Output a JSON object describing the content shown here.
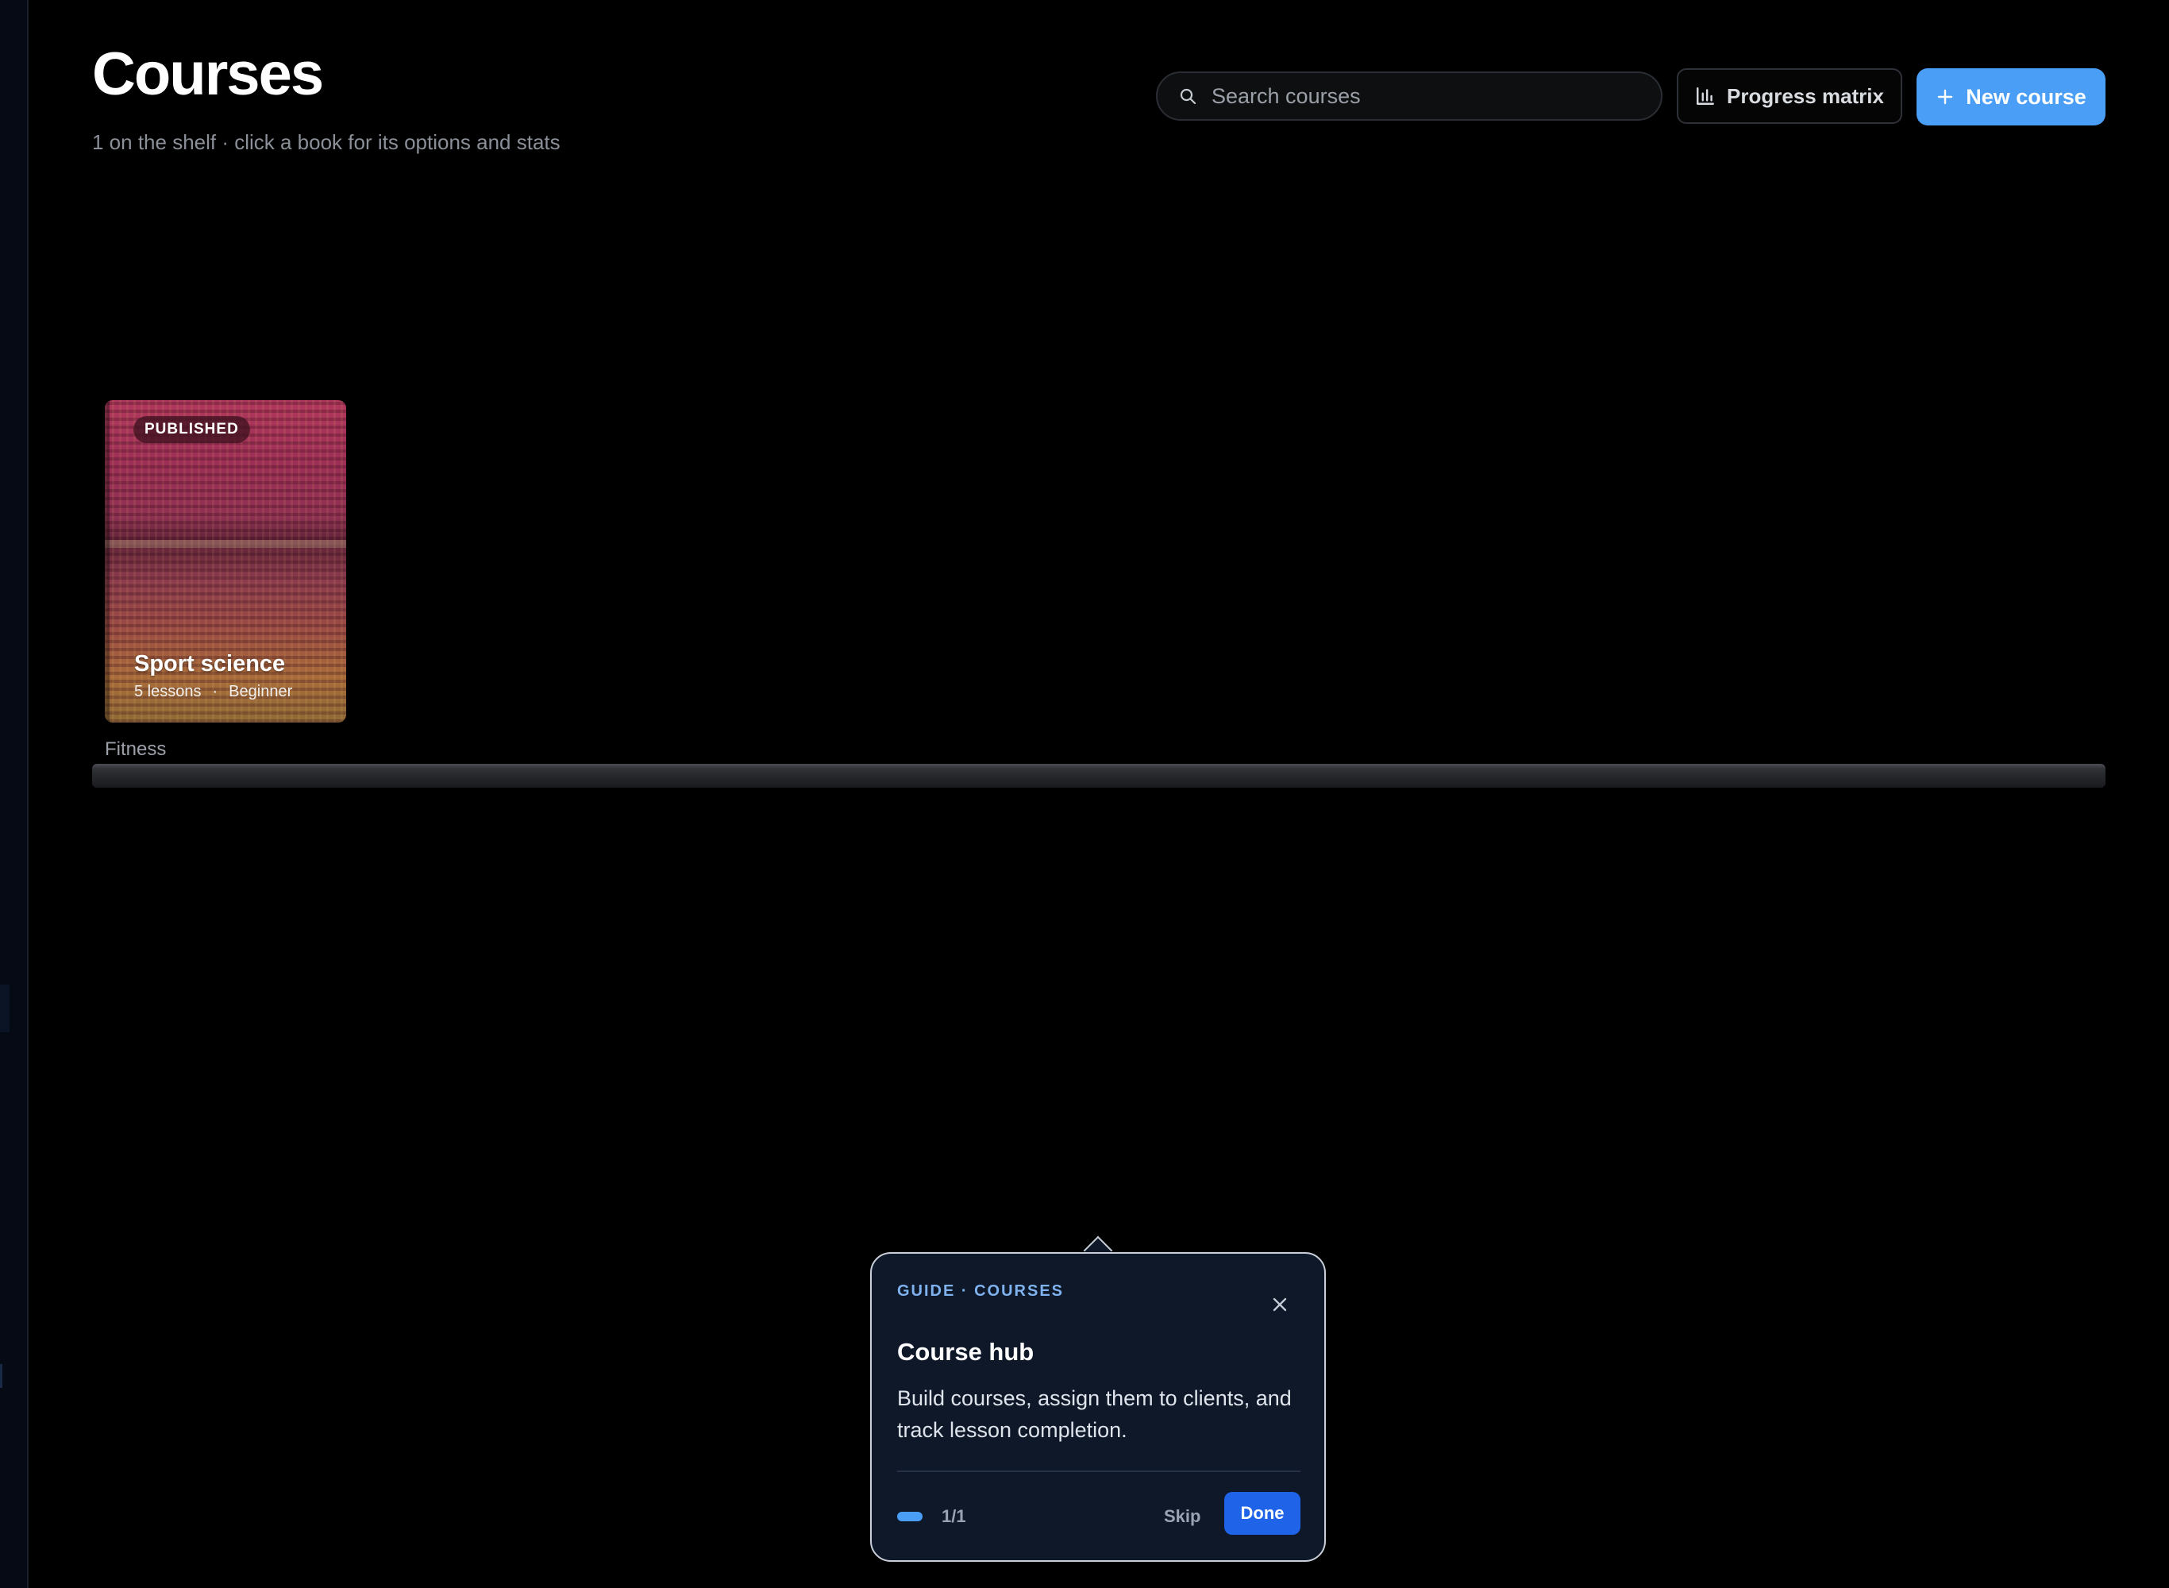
{
  "header": {
    "title": "Courses",
    "subtitle": "1 on the shelf · click a book for its options and stats"
  },
  "toolbar": {
    "search_placeholder": "Search courses",
    "search_value": "",
    "progress_matrix_label": "Progress matrix",
    "new_course_label": "New course"
  },
  "shelves": [
    {
      "label": "Fitness",
      "books": [
        {
          "status": "PUBLISHED",
          "title": "Sport science",
          "lessons": "5 lessons",
          "separator": "·",
          "level": "Beginner"
        }
      ]
    }
  ],
  "guide": {
    "eyebrow": "GUIDE · COURSES",
    "title": "Course hub",
    "body": "Build courses, assign them to clients, and track lesson completion.",
    "step": "1/1",
    "skip_label": "Skip",
    "done_label": "Done"
  },
  "colors": {
    "background": "#000000",
    "accent": "#4a9ef5",
    "done_button": "#1f63e8",
    "tooltip_bg": "#0e1828",
    "eyebrow": "#7fb2ee",
    "muted_text": "#8a8f98"
  },
  "icons": {
    "search": "search-icon",
    "matrix": "bar-chart-icon",
    "new": "plus-icon",
    "close": "close-icon"
  }
}
